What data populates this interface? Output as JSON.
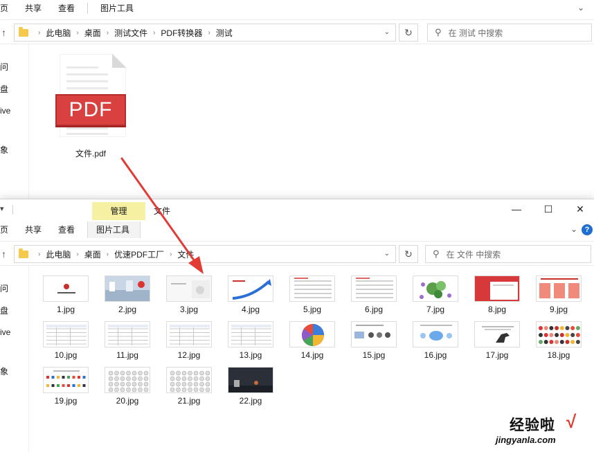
{
  "top_window": {
    "ribbon": {
      "tab_home_partial": "页",
      "tab_share": "共享",
      "tab_view": "查看",
      "tab_picture_tools": "图片工具"
    },
    "address": {
      "crumbs": [
        "此电脑",
        "桌面",
        "测试文件",
        "PDF转换器",
        "测试"
      ]
    },
    "search_placeholder": "在 测试 中搜索",
    "nav_items": [
      "问",
      "盘",
      "ive",
      "象"
    ],
    "file": {
      "icon_text": "PDF",
      "name": "文件.pdf"
    }
  },
  "bottom_window": {
    "titlebar": {
      "manage_tab": "管理",
      "title": "文件",
      "minimize": "—",
      "maximize": "☐",
      "close": "✕"
    },
    "ribbon": {
      "tab_home_partial": "页",
      "tab_share": "共享",
      "tab_view": "查看",
      "tab_picture_tools": "图片工具"
    },
    "address": {
      "crumbs": [
        "此电脑",
        "桌面",
        "优速PDF工厂",
        "文件"
      ]
    },
    "search_placeholder": "在 文件 中搜索",
    "nav_items": [
      "问",
      "盘",
      "ive",
      "象"
    ],
    "files": [
      {
        "name": "1.jpg",
        "thumb": "logo-white"
      },
      {
        "name": "2.jpg",
        "thumb": "photo-office"
      },
      {
        "name": "3.jpg",
        "thumb": "light-slide"
      },
      {
        "name": "4.jpg",
        "thumb": "blue-arrow"
      },
      {
        "name": "5.jpg",
        "thumb": "text-slide"
      },
      {
        "name": "6.jpg",
        "thumb": "text-slide"
      },
      {
        "name": "7.jpg",
        "thumb": "green-diagram"
      },
      {
        "name": "8.jpg",
        "thumb": "red-slide"
      },
      {
        "name": "9.jpg",
        "thumb": "red-cards"
      },
      {
        "name": "10.jpg",
        "thumb": "table"
      },
      {
        "name": "11.jpg",
        "thumb": "table"
      },
      {
        "name": "12.jpg",
        "thumb": "table"
      },
      {
        "name": "13.jpg",
        "thumb": "table"
      },
      {
        "name": "14.jpg",
        "thumb": "pie"
      },
      {
        "name": "15.jpg",
        "thumb": "flow"
      },
      {
        "name": "16.jpg",
        "thumb": "blue-bubbles"
      },
      {
        "name": "17.jpg",
        "thumb": "dino"
      },
      {
        "name": "18.jpg",
        "thumb": "dots-color"
      },
      {
        "name": "19.jpg",
        "thumb": "logos"
      },
      {
        "name": "20.jpg",
        "thumb": "dots-grey"
      },
      {
        "name": "21.jpg",
        "thumb": "dots-grey"
      },
      {
        "name": "22.jpg",
        "thumb": "dark-photo"
      }
    ]
  },
  "watermark": {
    "brand": "经验啦",
    "check": "√",
    "url": "jingyanla.com"
  },
  "colors": {
    "pdf_red": "#d8413f",
    "manage_tab": "#f5f0a2",
    "arrow": "#e23b34",
    "folder": "#f6c94b"
  }
}
